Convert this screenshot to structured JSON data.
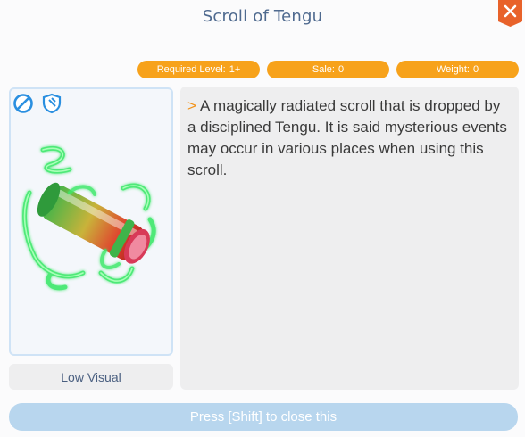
{
  "window": {
    "title": "Scroll of Tengu"
  },
  "close_icon": {
    "symbol": "✕",
    "color": "#e8622a"
  },
  "badges": [
    {
      "label": "Required Level:",
      "value": "1+"
    },
    {
      "label": "Sale:",
      "value": "0"
    },
    {
      "label": "Weight:",
      "value": "0"
    }
  ],
  "flags": [
    {
      "icon": "no-trade-icon",
      "color": "#2a8fe0"
    },
    {
      "icon": "shield-icon",
      "color": "#2a8fe0"
    }
  ],
  "item": {
    "icon": "scroll-icon",
    "glow_color": "#3ee86a"
  },
  "low_visual_label": "Low Visual",
  "description": {
    "arrow": ">",
    "text": "A magically radiated scroll that is dropped by a disciplined Tengu. It is said mysterious events may occur in various places when using this scroll."
  },
  "footer": {
    "label": "Press [Shift] to close this"
  },
  "colors": {
    "accent": "#f7a21b",
    "title": "#4f6a8f",
    "footer": "#b8d6ee"
  }
}
